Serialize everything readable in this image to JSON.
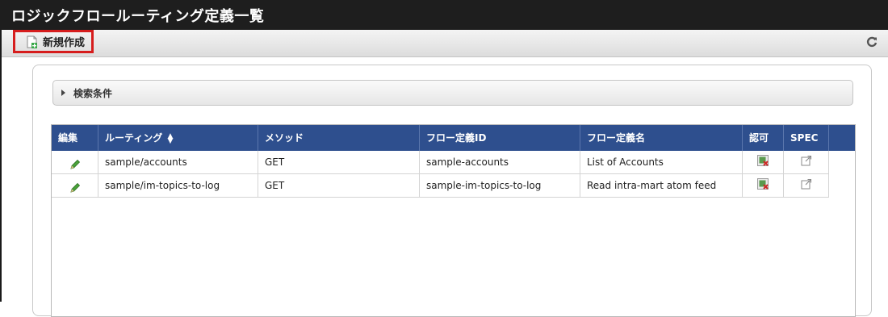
{
  "window": {
    "title": "ロジックフロールーティング定義一覧"
  },
  "toolbar": {
    "new_label": "新規作成",
    "new_icon": "new-document-icon",
    "refresh_icon": "refresh-icon",
    "highlight_color": "#d61d1d"
  },
  "search": {
    "label": "検索条件"
  },
  "table": {
    "header_color": "#2e4f8e",
    "columns": [
      "編集",
      "ルーティング",
      "メソッド",
      "フロー定義ID",
      "フロー定義名",
      "認可",
      "SPEC"
    ],
    "sort_icon": "sort-arrows-icon",
    "rows": [
      {
        "routing": "sample/accounts",
        "method": "GET",
        "flow_id": "sample-accounts",
        "flow_name": "List of Accounts"
      },
      {
        "routing": "sample/im-topics-to-log",
        "method": "GET",
        "flow_id": "sample-im-topics-to-log",
        "flow_name": "Read intra-mart atom feed"
      }
    ]
  }
}
